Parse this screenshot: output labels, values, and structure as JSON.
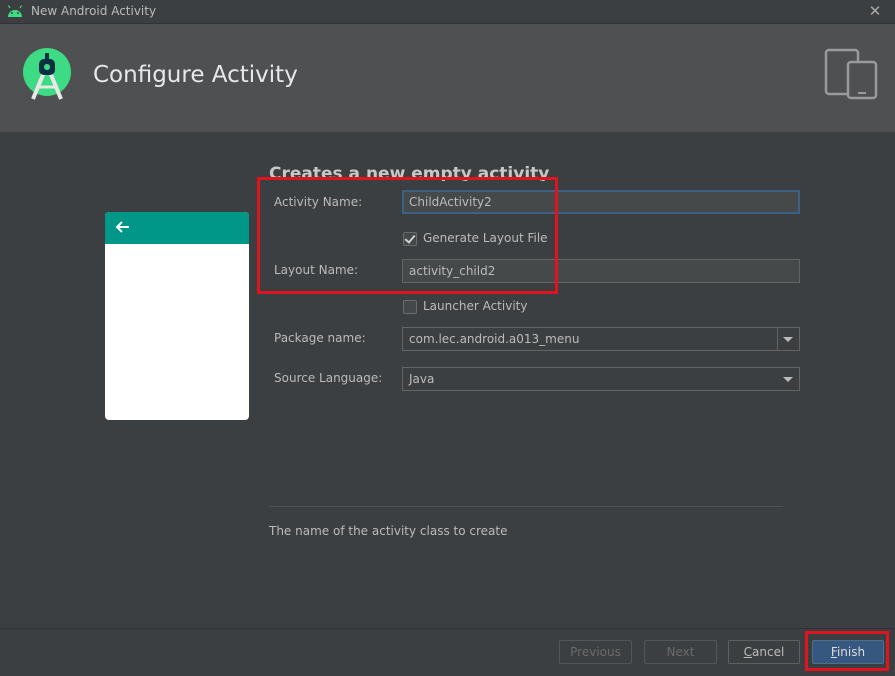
{
  "window": {
    "title": "New Android Activity",
    "close_glyph": "✕"
  },
  "header": {
    "title": "Configure Activity",
    "logo_icon": "android-studio-logo-icon",
    "device_icon": "tablet-phone-icon"
  },
  "main": {
    "section_title": "Creates a new empty activity"
  },
  "form": {
    "activity_name": {
      "label": "Activity Name:",
      "value": "ChildActivity2"
    },
    "generate_layout": {
      "label": "Generate Layout File",
      "checked": true
    },
    "layout_name": {
      "label": "Layout Name:",
      "value": "activity_child2"
    },
    "launcher_activity": {
      "label": "Launcher Activity",
      "checked": false
    },
    "package_name": {
      "label": "Package name:",
      "value": "com.lec.android.a013_menu"
    },
    "source_language": {
      "label": "Source Language:",
      "value": "Java"
    }
  },
  "hint": "The name of the activity class to create",
  "buttons": {
    "previous": "Previous",
    "next": "Next",
    "cancel_prefix": "C",
    "cancel_rest": "ancel",
    "finish_prefix": "F",
    "finish_rest": "inish"
  },
  "colors": {
    "accent": "#009688",
    "highlight": "#e0141e",
    "primary_button": "#365880",
    "android_green": "#3ddc84"
  }
}
